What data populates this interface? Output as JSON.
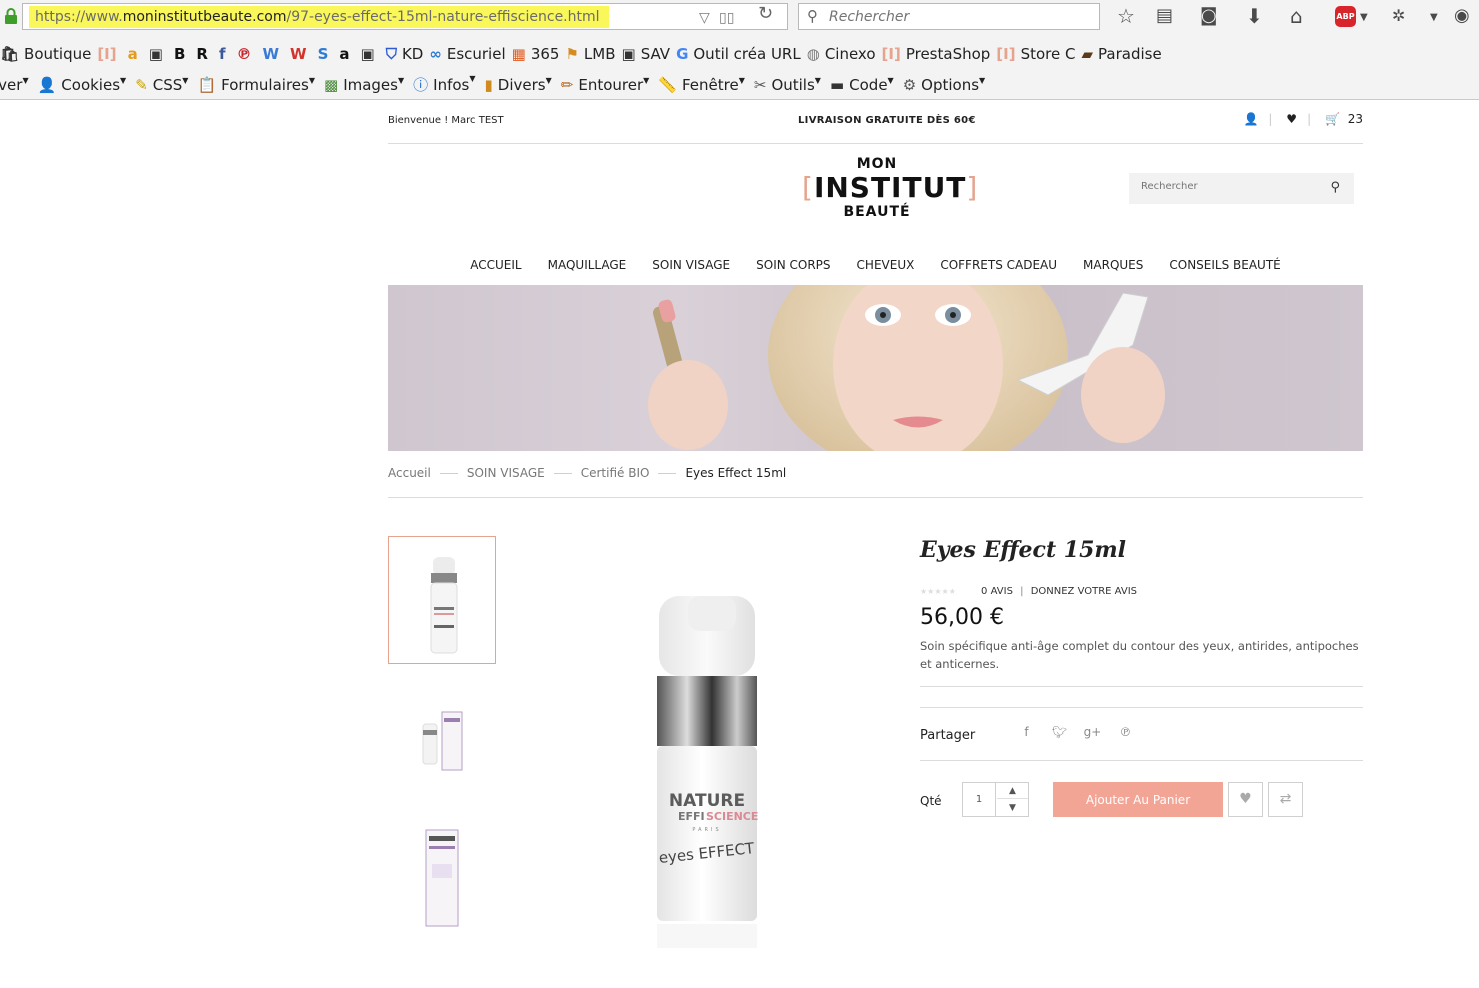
{
  "browser": {
    "url_prefix": "https://www.",
    "url_domain": "moninstitutbeaute.com",
    "url_path": "/97-eyes-effect-15ml-nature-effiscience.html",
    "search_placeholder": "Rechercher",
    "abp_label": "ABP",
    "bookmarks": [
      {
        "icon": "shopping-icon",
        "label": "Boutique"
      },
      {
        "icon": "bracket-i-icon",
        "label": ""
      },
      {
        "icon": "amazon-icon",
        "label": ""
      },
      {
        "icon": "bag-icon",
        "label": ""
      },
      {
        "icon": "letter-b-icon",
        "label": ""
      },
      {
        "icon": "letter-r-icon",
        "label": ""
      },
      {
        "icon": "facebook-icon",
        "label": ""
      },
      {
        "icon": "pinterest-icon",
        "label": ""
      },
      {
        "icon": "w-icon",
        "label": ""
      },
      {
        "icon": "w-red-icon",
        "label": ""
      },
      {
        "icon": "s-icon",
        "label": ""
      },
      {
        "icon": "amazon-black-icon",
        "label": ""
      },
      {
        "icon": "bag-icon",
        "label": ""
      },
      {
        "icon": "shield-icon",
        "label": "KD"
      },
      {
        "icon": "infinity-icon",
        "label": "Escuriel"
      },
      {
        "icon": "windows-icon",
        "label": "365"
      },
      {
        "icon": "ladder-icon",
        "label": "LMB"
      },
      {
        "icon": "bag-icon",
        "label": "SAV"
      },
      {
        "icon": "google-icon",
        "label": "Outil créa URL"
      },
      {
        "icon": "globe-icon",
        "label": "Cinexo"
      },
      {
        "icon": "bracket-i-icon",
        "label": "PrestaShop"
      },
      {
        "icon": "bracket-i-icon",
        "label": "Store C"
      },
      {
        "icon": "picture-icon",
        "label": "Paradise"
      }
    ],
    "tools": [
      {
        "icon": "",
        "label": "iver"
      },
      {
        "icon": "user-icon",
        "label": "Cookies"
      },
      {
        "icon": "wand-icon",
        "label": "CSS"
      },
      {
        "icon": "clipboard-icon",
        "label": "Formulaires"
      },
      {
        "icon": "image-icon",
        "label": "Images"
      },
      {
        "icon": "info-icon",
        "label": "Infos"
      },
      {
        "icon": "book-icon",
        "label": "Divers"
      },
      {
        "icon": "pencil-icon",
        "label": "Entourer"
      },
      {
        "icon": "ruler-icon",
        "label": "Fenêtre"
      },
      {
        "icon": "tools-icon",
        "label": "Outils"
      },
      {
        "icon": "terminal-icon",
        "label": "Code"
      },
      {
        "icon": "settings-icon",
        "label": "Options"
      }
    ]
  },
  "site": {
    "welcome": "Bienvenue ! Marc TEST",
    "free_shipping": "LIVRAISON GRATUITE DÈS 60€",
    "cart_count": "23",
    "logo": {
      "line1": "MON",
      "line2": "INSTITUT",
      "line3": "BEAUTÉ"
    },
    "search_placeholder": "Rechercher",
    "nav": [
      "ACCUEIL",
      "MAQUILLAGE",
      "SOIN VISAGE",
      "SOIN CORPS",
      "CHEVEUX",
      "COFFRETS CADEAU",
      "MARQUES",
      "CONSEILS BEAUTÉ"
    ],
    "breadcrumb": [
      "Accueil",
      "SOIN VISAGE",
      "Certifié BIO",
      "Eyes Effect 15ml"
    ]
  },
  "product": {
    "title": "Eyes Effect 15ml",
    "reviews": "0 AVIS",
    "give_review": "DONNEZ VOTRE AVIS",
    "rating_value": 0,
    "rating_max": 5,
    "price": "56,00 €",
    "description": "Soin spécifique anti-âge complet du contour des yeux, antirides, antipoches et anticernes.",
    "share_label": "Partager",
    "qty_label": "Qté",
    "qty_value": "1",
    "add_to_cart": "Ajouter Au Panier",
    "brand_line1": "NATURE",
    "brand_line2_a": "EFFI",
    "brand_line2_b": "SCIENCE",
    "brand_line3": "PARIS",
    "product_line": "eyes EFFECT"
  },
  "colors": {
    "accent": "#f2a495",
    "highlight": "#f9f75a",
    "logo_bracket": "#e6a48f"
  }
}
